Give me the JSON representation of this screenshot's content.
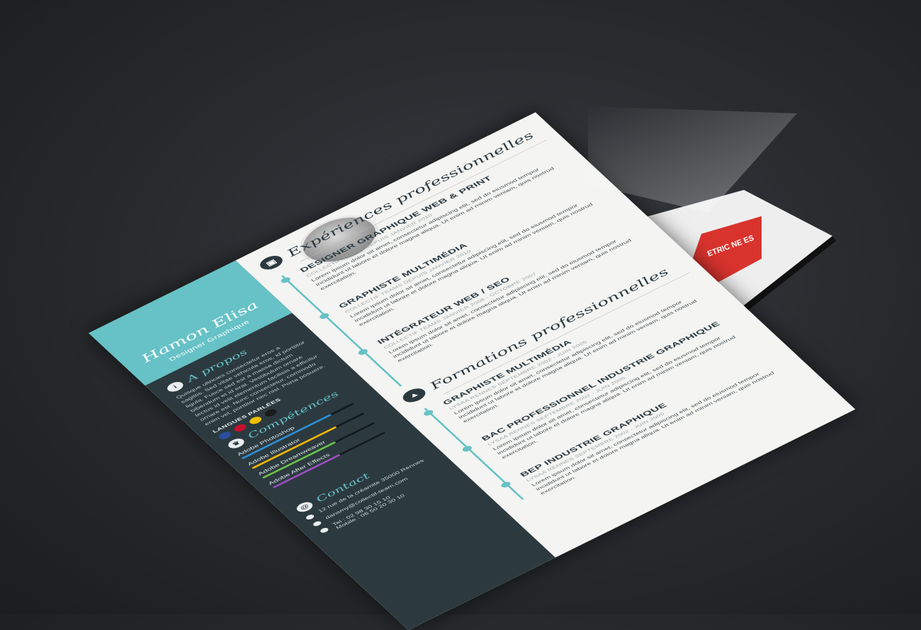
{
  "resume": {
    "name": "Hamon Elisa",
    "role": "Designer Graphique",
    "about": {
      "title": "A propos",
      "text": "Quisque ultricies consectetur eros a sagittis. Sed vitae vehicula eros, id porttitor ligula. Fusce sed est a massa dictum bibendum et id erat. Vestibulum ornare lectus id velit elementum facilisis a efficitur ornare est. Nunc consectetur, commodo enim vel, porttitor nec nisl. Porta posuere."
    },
    "languages": {
      "title": "LANGUES PARLÉES",
      "flags": [
        "#2a4ea0",
        "#c8102e",
        "#f1bf00",
        "#1b1b1b"
      ]
    },
    "skills": {
      "title": "Compétences",
      "items": [
        {
          "name": "Adobe Photoshop",
          "color": "#2e8fd6",
          "level": 0.8
        },
        {
          "name": "Adobe Illustrator",
          "color": "#f2b705",
          "level": 0.75
        },
        {
          "name": "Adobe Dreamweaver",
          "color": "#6cc04a",
          "level": 0.65
        },
        {
          "name": "Adobe After Effects",
          "color": "#9b4fc0",
          "level": 0.6
        }
      ]
    },
    "contact": {
      "title": "Contact",
      "address": "12 rue de la créamite 35000 Rennes",
      "email": "dansmy@collectif-team.com",
      "phone": "Tel : 02 98 30 15 10",
      "mobile": "Mobile : 06 50 20 30 10"
    },
    "experience": {
      "title": "Expériences professionnelles",
      "entries": [
        {
          "title": "DESIGNER GRAPHIQUE WEB & PRINT",
          "meta": "COLLECTIF TEAMS    DEPUIS JANVIER 2010",
          "text": "Lorem ipsum dolor sit amet, consectetur adipiscing elit, sed do eiusmod tempor incididunt ut labore et dolore magna aliqua. Ut enim ad minim veniam, quis nostrud exercitation."
        },
        {
          "title": "GRAPHISTE MULTIMÉDIA",
          "meta": "COLLECTIF TEAMS    DEPUIS JANVIER 2010",
          "text": "Lorem ipsum dolor sit amet, consectetur adipiscing elit, sed do eiusmod tempor incididunt ut labore et dolore magna aliqua. Ut enim ad minim veniam, quis nostrud exercitation."
        },
        {
          "title": "INTÉGRATEUR WEB / SEO",
          "meta": "COLLECTIF TEAMS    JANVIER 2006 - OCTOBRE 2007",
          "text": "Lorem ipsum dolor sit amet, consectetur adipiscing elit, sed do eiusmod tempor incididunt ut labore et dolore magna aliqua. Ut enim ad minim veniam, quis nostrud exercitation."
        }
      ]
    },
    "education": {
      "title": "Formations professionnelles",
      "entries": [
        {
          "title": "GRAPHISTE MULTIMÉDIA",
          "meta": "LYSAA RENNES    SEPTEMBRE 2002 - JUIN 2005",
          "text": "Lorem ipsum dolor sit amet, consectetur adipiscing elit, sed do eiusmod tempor incididunt ut labore et dolore magna aliqua. Ut enim ad minim veniam, quis nostrud exercitation."
        },
        {
          "title": "BAC PROFESSIONNEL INDUSTRIE GRAPHIQUE",
          "meta": "LYSAA RENNES    SEPTEMBRE 2002 - JUIN 2005",
          "text": "Lorem ipsum dolor sit amet, consectetur adipiscing elit, sed do eiusmod tempor incididunt ut labore et dolore magna aliqua. Ut enim ad minim veniam, quis nostrud exercitation."
        },
        {
          "title": "BEP INDUSTRIE GRAPHIQUE",
          "meta": "LYSAA RENNES    SEPTEMBRE 2002 - JUIN 2005",
          "text": "Lorem ipsum dolor sit amet, consectetur adipiscing elit, sed do eiusmod tempor incididunt ut labore et dolore magna aliqua. Ut enim ad minim veniam, quis nostrud exercitation."
        }
      ]
    }
  },
  "back_sheet": {
    "red_block_text": "ETRIC NE ES"
  }
}
